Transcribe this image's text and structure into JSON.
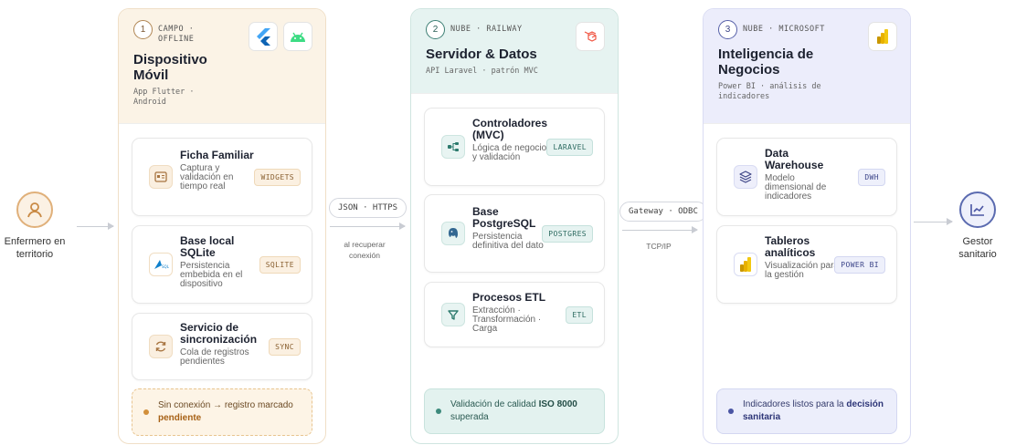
{
  "actors": {
    "left": {
      "label": "Enfermero en territorio",
      "icon": "person-icon"
    },
    "right": {
      "label": "Gestor sanitario",
      "icon": "trend-chart-icon"
    }
  },
  "connectors": {
    "c1": {
      "pill": "JSON · HTTPS",
      "note": "al recuperar conexión"
    },
    "c2": {
      "pill": "Gateway · ODBC",
      "note": "TCP/IP"
    }
  },
  "columns": [
    {
      "number": "1",
      "tag": "CAMPO · OFFLINE",
      "title": "Dispositivo Móvil",
      "subtitle": "App Flutter · Android",
      "logos": [
        "flutter-logo",
        "android-logo"
      ],
      "cards": [
        {
          "title": "Ficha Familiar",
          "desc": "Captura y validación en tiempo real",
          "tag": "WIDGETS",
          "icon": "id-card-icon"
        },
        {
          "title": "Base local SQLite",
          "desc": "Persistencia embebida en el dispositivo",
          "tag": "SQLITE",
          "icon": "sqlite-icon"
        },
        {
          "title": "Servicio de sincronización",
          "desc": "Cola de registros pendientes",
          "tag": "SYNC",
          "icon": "sync-icon"
        }
      ],
      "footer": {
        "text": "Sin conexión → registro marcado",
        "strong": "pendiente"
      }
    },
    {
      "number": "2",
      "tag": "NUBE · RAILWAY",
      "title": "Servidor & Datos",
      "subtitle": "API Laravel · patrón MVC",
      "logos": [
        "laravel-logo"
      ],
      "cards": [
        {
          "title": "Controladores (MVC)",
          "desc": "Lógica de negocio y validación",
          "tag": "LARAVEL",
          "icon": "flow-nodes-icon"
        },
        {
          "title": "Base PostgreSQL",
          "desc": "Persistencia definitiva del dato",
          "tag": "POSTGRES",
          "icon": "postgres-elephant-icon"
        },
        {
          "title": "Procesos ETL",
          "desc": "Extracción · Transformación · Carga",
          "tag": "ETL",
          "icon": "funnel-icon"
        }
      ],
      "footer": {
        "text": "Validación de calidad",
        "strong": "ISO 8000",
        "tail": "superada"
      }
    },
    {
      "number": "3",
      "tag": "NUBE · MICROSOFT",
      "title": "Inteligencia de Negocios",
      "subtitle": "Power BI · análisis de indicadores",
      "logos": [
        "powerbi-logo"
      ],
      "cards": [
        {
          "title": "Data Warehouse",
          "desc": "Modelo dimensional de indicadores",
          "tag": "DWH",
          "icon": "layers-icon"
        },
        {
          "title": "Tableros analíticos",
          "desc": "Visualización para la gestión",
          "tag": "POWER BI",
          "icon": "powerbi-icon"
        }
      ],
      "footer": {
        "text": "Indicadores listos para la",
        "strong": "decisión sanitaria"
      }
    }
  ],
  "colors": {
    "col1_accent": "#d28f3a",
    "col2_accent": "#3d8a7c",
    "col3_accent": "#4a55a3"
  }
}
